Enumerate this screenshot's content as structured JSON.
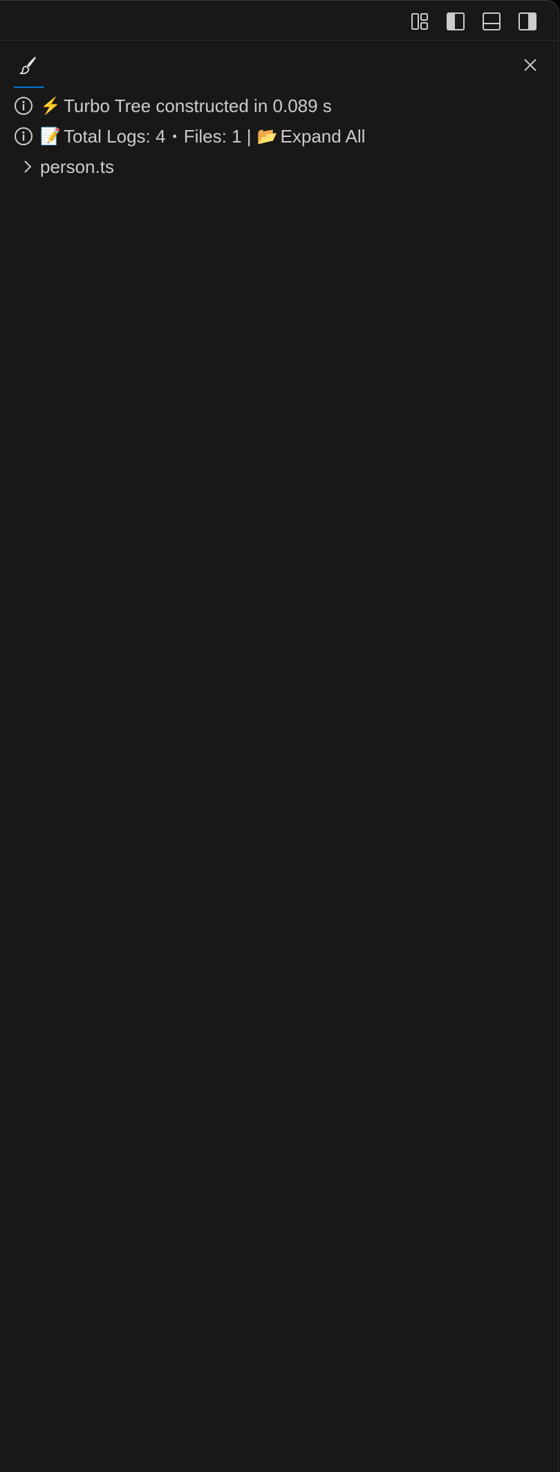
{
  "titlebar": {
    "layout_buttons": [
      {
        "name": "customize-layout-icon"
      },
      {
        "name": "toggle-primary-sidebar-icon"
      },
      {
        "name": "toggle-panel-icon"
      },
      {
        "name": "toggle-secondary-sidebar-icon"
      }
    ]
  },
  "panel": {
    "tab_icon": "brush-icon",
    "close_icon": "close-icon"
  },
  "tree": {
    "info1": {
      "emoji": "⚡",
      "text": "Turbo Tree constructed in 0.089 s"
    },
    "info2": {
      "emoji": "📝",
      "logs_text": "Total Logs: 4",
      "bullet": "•",
      "files_text": "Files: 1 |",
      "folder_emoji": "📂",
      "expand_label": "Expand All"
    },
    "file": {
      "name": "person.ts"
    }
  },
  "colors": {
    "background": "#181818",
    "text": "#cccccc",
    "accent": "#0078d4"
  }
}
